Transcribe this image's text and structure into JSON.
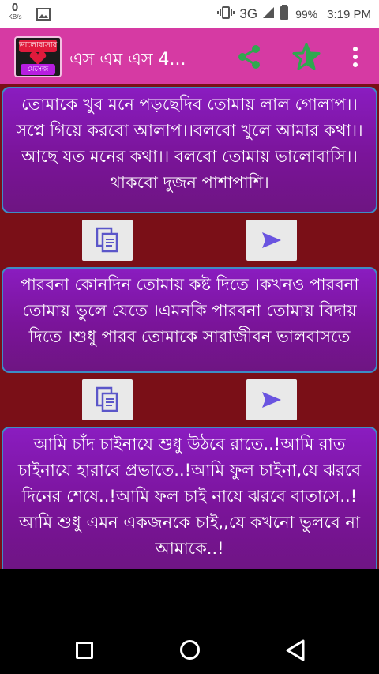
{
  "status_bar": {
    "speed_value": "0",
    "speed_unit": "KB/s",
    "network": "3G",
    "battery": "99%",
    "time": "3:19 PM"
  },
  "app_bar": {
    "logo_top": "ভালোবাসার",
    "logo_bottom": "মেসেজ",
    "title": "এস এম এস 4...",
    "accent_color": "#d63aa3",
    "icons": [
      "share-icon",
      "star-icon",
      "more-vert-icon"
    ]
  },
  "messages": [
    {
      "text": "তোমাকে খুব মনে পড়ছেদিব তোমায় লাল গোলাপ।।সপ্নে গিয়ে করবো আলাপ।।বলবো খুলে আমার কথা।।আছে যত মনের কথা।। বলবো তোমায় ভালোবাসি।।থাকবো দুজন পাশাপাশি।"
    },
    {
      "text": "পারবনা কোনদিন তোমায় কষ্ট দিতে ।কখনও পারবনা তোমায় ভুলে যেতে ।এমনকি পারবনা তোমায় বিদায় দিতে ।শুধু পারব তোমাকে সারাজীবন ভালবাসতে"
    },
    {
      "text": "আমি চাঁদ চাইনাযে শুধু উঠবে রাতে..!আমি রাত চাইনাযে হারাবে প্রভাতে..!আমি ফুল চাইনা,যে ঝরবে দিনের শেষে..!আমি ফল চাই নাযে ঝরবে বাতাসে..!আমি শুধু এমন একজনকে চাই,,যে কখনো ভুলবে না আমাকে..!"
    }
  ],
  "colors": {
    "background": "#7a0f17",
    "card_border": "#3c8dc6",
    "card_fill": "#7a1499",
    "send_icon": "#6a54e0",
    "copy_icon": "#5b56c9"
  },
  "nav_bar": {
    "icons": [
      "square-icon",
      "circle-icon",
      "triangle-back-icon"
    ]
  }
}
